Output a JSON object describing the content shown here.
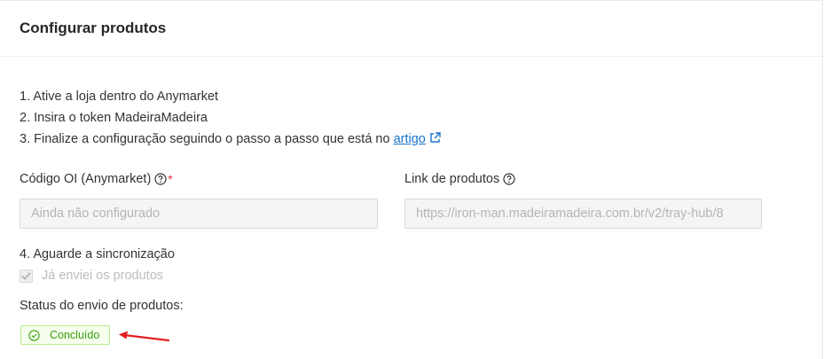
{
  "header": {
    "title": "Configurar produtos"
  },
  "steps": {
    "step1": "1. Ative a loja dentro do Anymarket",
    "step2": "2. Insira o token MadeiraMadeira",
    "step3_prefix": "3. Finalize a configuração seguindo o passo a passo que está no ",
    "step3_link": "artigo",
    "step3_link_icon": "external-link-icon"
  },
  "fields": {
    "codigo": {
      "label": "Código OI (Anymarket)",
      "required_mark": "*",
      "placeholder": "Ainda não configurado",
      "icon": "help-circle-icon"
    },
    "link": {
      "label": "Link de produtos",
      "value": "https://iron-man.madeiramadeira.com.br/v2/tray-hub/8",
      "icon": "help-circle-icon"
    }
  },
  "sync": {
    "title": "4. Aguarde a sincronização",
    "checkbox_label": "Já enviei os produtos",
    "checkbox_checked": true
  },
  "status": {
    "label": "Status do envio de produtos:",
    "badge_text": "Concluído",
    "badge_icon": "check-circle-icon"
  },
  "colors": {
    "link": "#1a73c8",
    "required": "#e03a3a",
    "success_text": "#389e0d",
    "success_bg": "#f6ffed",
    "success_border": "#b7eb8f",
    "annotation_arrow": "#e02020"
  }
}
